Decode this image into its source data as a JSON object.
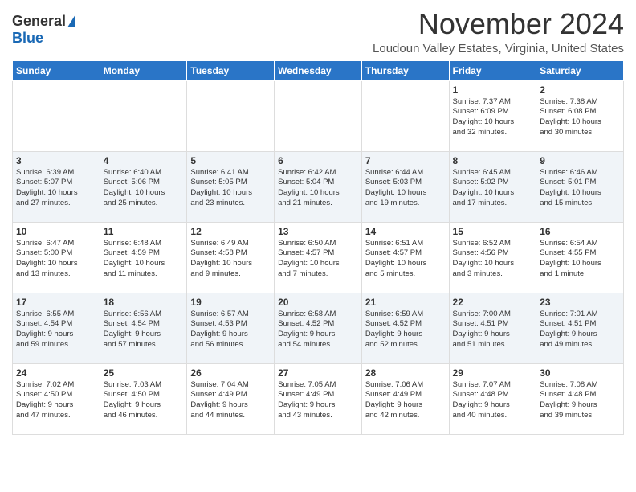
{
  "header": {
    "logo_general": "General",
    "logo_blue": "Blue",
    "month_title": "November 2024",
    "location": "Loudoun Valley Estates, Virginia, United States"
  },
  "weekdays": [
    "Sunday",
    "Monday",
    "Tuesday",
    "Wednesday",
    "Thursday",
    "Friday",
    "Saturday"
  ],
  "weeks": [
    [
      {
        "day": "",
        "info": ""
      },
      {
        "day": "",
        "info": ""
      },
      {
        "day": "",
        "info": ""
      },
      {
        "day": "",
        "info": ""
      },
      {
        "day": "",
        "info": ""
      },
      {
        "day": "1",
        "info": "Sunrise: 7:37 AM\nSunset: 6:09 PM\nDaylight: 10 hours\nand 32 minutes."
      },
      {
        "day": "2",
        "info": "Sunrise: 7:38 AM\nSunset: 6:08 PM\nDaylight: 10 hours\nand 30 minutes."
      }
    ],
    [
      {
        "day": "3",
        "info": "Sunrise: 6:39 AM\nSunset: 5:07 PM\nDaylight: 10 hours\nand 27 minutes."
      },
      {
        "day": "4",
        "info": "Sunrise: 6:40 AM\nSunset: 5:06 PM\nDaylight: 10 hours\nand 25 minutes."
      },
      {
        "day": "5",
        "info": "Sunrise: 6:41 AM\nSunset: 5:05 PM\nDaylight: 10 hours\nand 23 minutes."
      },
      {
        "day": "6",
        "info": "Sunrise: 6:42 AM\nSunset: 5:04 PM\nDaylight: 10 hours\nand 21 minutes."
      },
      {
        "day": "7",
        "info": "Sunrise: 6:44 AM\nSunset: 5:03 PM\nDaylight: 10 hours\nand 19 minutes."
      },
      {
        "day": "8",
        "info": "Sunrise: 6:45 AM\nSunset: 5:02 PM\nDaylight: 10 hours\nand 17 minutes."
      },
      {
        "day": "9",
        "info": "Sunrise: 6:46 AM\nSunset: 5:01 PM\nDaylight: 10 hours\nand 15 minutes."
      }
    ],
    [
      {
        "day": "10",
        "info": "Sunrise: 6:47 AM\nSunset: 5:00 PM\nDaylight: 10 hours\nand 13 minutes."
      },
      {
        "day": "11",
        "info": "Sunrise: 6:48 AM\nSunset: 4:59 PM\nDaylight: 10 hours\nand 11 minutes."
      },
      {
        "day": "12",
        "info": "Sunrise: 6:49 AM\nSunset: 4:58 PM\nDaylight: 10 hours\nand 9 minutes."
      },
      {
        "day": "13",
        "info": "Sunrise: 6:50 AM\nSunset: 4:57 PM\nDaylight: 10 hours\nand 7 minutes."
      },
      {
        "day": "14",
        "info": "Sunrise: 6:51 AM\nSunset: 4:57 PM\nDaylight: 10 hours\nand 5 minutes."
      },
      {
        "day": "15",
        "info": "Sunrise: 6:52 AM\nSunset: 4:56 PM\nDaylight: 10 hours\nand 3 minutes."
      },
      {
        "day": "16",
        "info": "Sunrise: 6:54 AM\nSunset: 4:55 PM\nDaylight: 10 hours\nand 1 minute."
      }
    ],
    [
      {
        "day": "17",
        "info": "Sunrise: 6:55 AM\nSunset: 4:54 PM\nDaylight: 9 hours\nand 59 minutes."
      },
      {
        "day": "18",
        "info": "Sunrise: 6:56 AM\nSunset: 4:54 PM\nDaylight: 9 hours\nand 57 minutes."
      },
      {
        "day": "19",
        "info": "Sunrise: 6:57 AM\nSunset: 4:53 PM\nDaylight: 9 hours\nand 56 minutes."
      },
      {
        "day": "20",
        "info": "Sunrise: 6:58 AM\nSunset: 4:52 PM\nDaylight: 9 hours\nand 54 minutes."
      },
      {
        "day": "21",
        "info": "Sunrise: 6:59 AM\nSunset: 4:52 PM\nDaylight: 9 hours\nand 52 minutes."
      },
      {
        "day": "22",
        "info": "Sunrise: 7:00 AM\nSunset: 4:51 PM\nDaylight: 9 hours\nand 51 minutes."
      },
      {
        "day": "23",
        "info": "Sunrise: 7:01 AM\nSunset: 4:51 PM\nDaylight: 9 hours\nand 49 minutes."
      }
    ],
    [
      {
        "day": "24",
        "info": "Sunrise: 7:02 AM\nSunset: 4:50 PM\nDaylight: 9 hours\nand 47 minutes."
      },
      {
        "day": "25",
        "info": "Sunrise: 7:03 AM\nSunset: 4:50 PM\nDaylight: 9 hours\nand 46 minutes."
      },
      {
        "day": "26",
        "info": "Sunrise: 7:04 AM\nSunset: 4:49 PM\nDaylight: 9 hours\nand 44 minutes."
      },
      {
        "day": "27",
        "info": "Sunrise: 7:05 AM\nSunset: 4:49 PM\nDaylight: 9 hours\nand 43 minutes."
      },
      {
        "day": "28",
        "info": "Sunrise: 7:06 AM\nSunset: 4:49 PM\nDaylight: 9 hours\nand 42 minutes."
      },
      {
        "day": "29",
        "info": "Sunrise: 7:07 AM\nSunset: 4:48 PM\nDaylight: 9 hours\nand 40 minutes."
      },
      {
        "day": "30",
        "info": "Sunrise: 7:08 AM\nSunset: 4:48 PM\nDaylight: 9 hours\nand 39 minutes."
      }
    ]
  ]
}
